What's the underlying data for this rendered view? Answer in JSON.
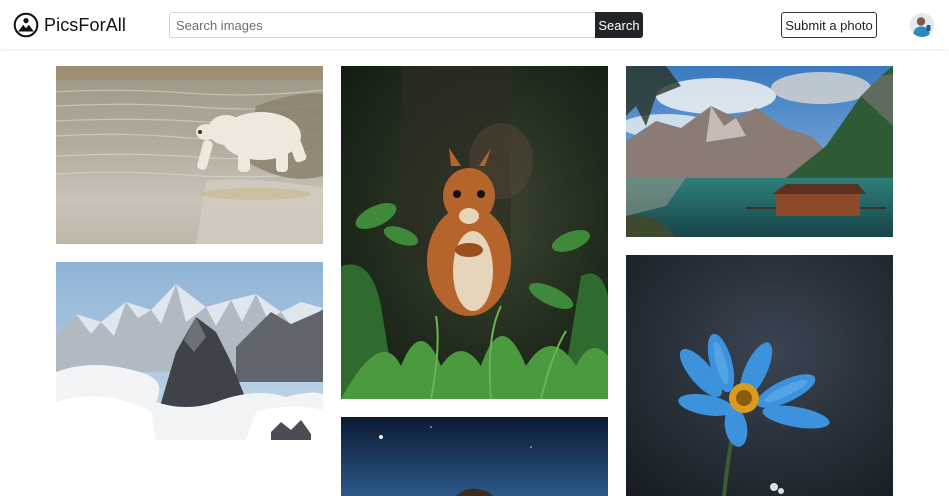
{
  "header": {
    "brand_name": "PicsForAll",
    "brand_icon": "camera-aperture-logo-icon",
    "search": {
      "placeholder": "Search images",
      "value": "",
      "button_label": "Search"
    },
    "submit_label": "Submit a photo",
    "avatar_icon": "user-avatar-icon"
  },
  "colors": {
    "dark_button": "#212529",
    "border": "#d3d3d3",
    "page_background": "#ffffff"
  },
  "gallery": {
    "photos": [
      {
        "subject": "polar bear wading in water"
      },
      {
        "subject": "red squirrel in grass"
      },
      {
        "subject": "mountain lake with boathouse"
      },
      {
        "subject": "snowy mountain peaks above clouds"
      },
      {
        "subject": "blue daisy flower"
      },
      {
        "subject": "night sky over hill"
      }
    ]
  }
}
